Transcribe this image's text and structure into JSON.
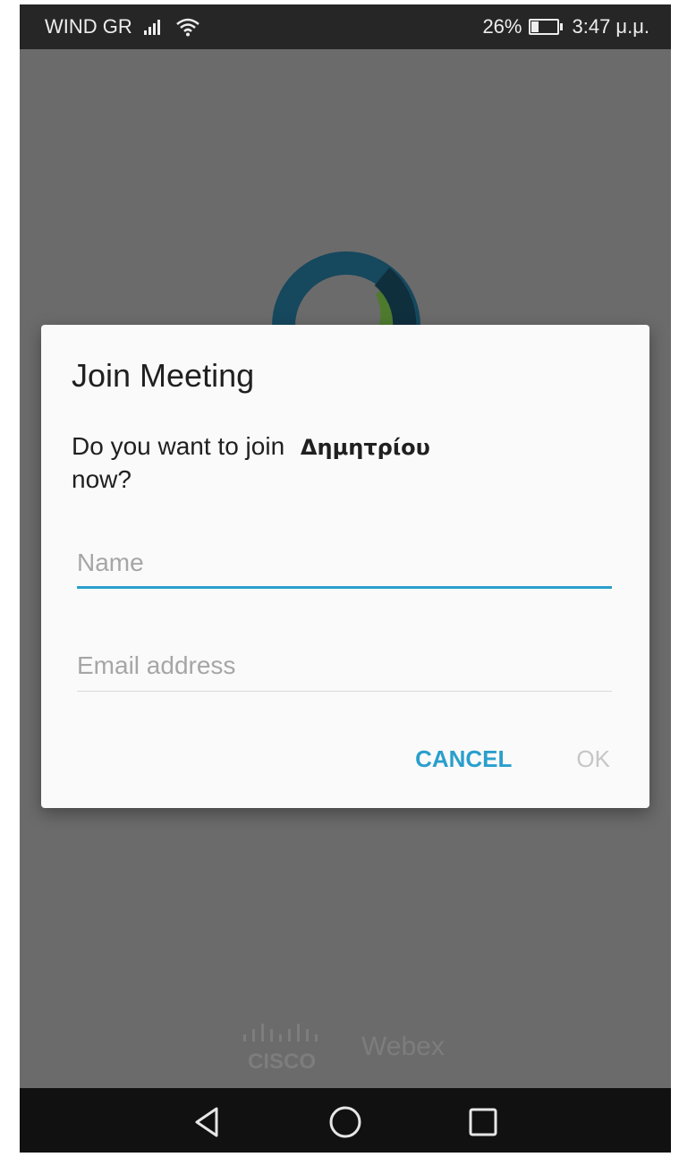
{
  "status_bar": {
    "carrier": "WIND GR",
    "battery": "26%",
    "battery_level": 0.26,
    "time": "3:47 μ.μ.",
    "icons": [
      "signal-icon",
      "wifi-icon",
      "battery-icon"
    ]
  },
  "dialog": {
    "title": "Join Meeting",
    "message_prefix": "Do you want to join",
    "meeting_host": "Δημητρίου",
    "message_suffix": "now?",
    "name_placeholder": "Name",
    "name_value": "",
    "email_placeholder": "Email address",
    "email_value": "",
    "cancel_label": "CANCEL",
    "ok_label": "OK"
  },
  "branding": {
    "cisco": "CISCO",
    "product": "Webex"
  },
  "navigation": {
    "icons": [
      "back-icon",
      "home-icon",
      "recents-icon"
    ]
  },
  "colors": {
    "accent": "#2a9fcd",
    "background_dim": "#6b6b6b",
    "dialog_bg": "#fafafa",
    "disabled_text": "#c6c6c6"
  }
}
